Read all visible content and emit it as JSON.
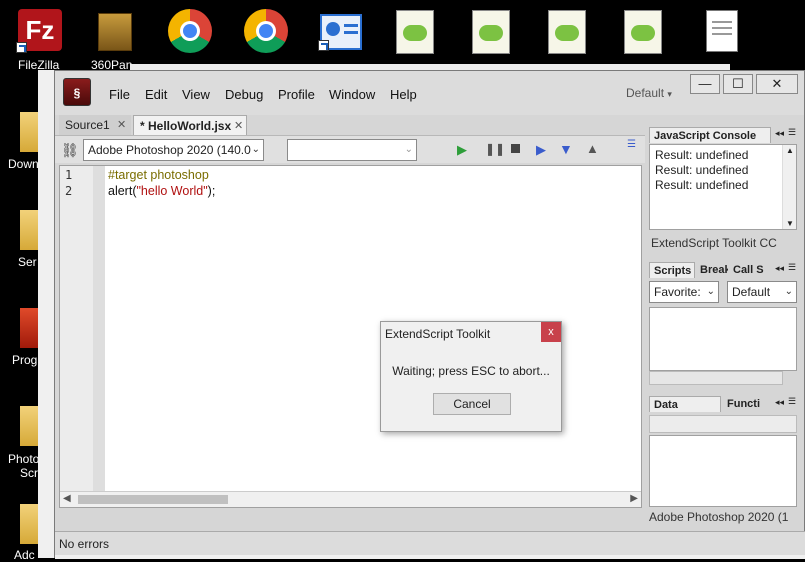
{
  "desktop": {
    "icons": [
      {
        "label": "FileZilla",
        "icon": "filezilla-icon"
      },
      {
        "label": "360Pan",
        "icon": "folder-icon"
      },
      {
        "label": "",
        "icon": "chrome-icon"
      },
      {
        "label": "",
        "icon": "chrome-icon"
      },
      {
        "label": "",
        "icon": "app-shortcut-icon"
      },
      {
        "label": "",
        "icon": "notepad-plus-plus-icon"
      },
      {
        "label": "",
        "icon": "notepad-plus-plus-icon"
      },
      {
        "label": "",
        "icon": "notepad-plus-plus-icon"
      },
      {
        "label": "",
        "icon": "notepad-plus-plus-icon"
      },
      {
        "label": "",
        "icon": "text-document-icon"
      }
    ],
    "left_labels": [
      "Down",
      "Ser",
      "Prog",
      "Photo",
      "Scr",
      "Adc"
    ]
  },
  "window": {
    "menu": [
      "File",
      "Edit",
      "View",
      "Debug",
      "Profile",
      "Window",
      "Help"
    ],
    "workspace": "Default",
    "controls": {
      "minimize": "—",
      "maximize": "☐",
      "close": "✕"
    },
    "tabs": [
      "Source1",
      "* HelloWorld.jsx"
    ],
    "target_app": "Adobe Photoshop 2020 (140.0",
    "function_select": "",
    "code_lines": [
      {
        "num": "1",
        "text": "#target photoshop"
      },
      {
        "num": "2",
        "text_parts": [
          "alert(",
          "\"hello World\"",
          ");"
        ]
      }
    ],
    "status": "No errors"
  },
  "console": {
    "title": "JavaScript Console",
    "lines": [
      "Result: undefined",
      "Result: undefined",
      "Result: undefined"
    ],
    "footer": "ExtendScript Toolkit CC"
  },
  "scripts_panel": {
    "tabs": [
      "Scripts",
      "Break",
      "Call S"
    ],
    "favorites": "Favorite:",
    "default": "Default"
  },
  "data_panel": {
    "tabs": [
      "Data Browser",
      "Functi"
    ],
    "footer": "Adobe Photoshop 2020 (1"
  },
  "dialog": {
    "title": "ExtendScript Toolkit",
    "message": "Waiting; press ESC to abort...",
    "button": "Cancel"
  },
  "colors": {
    "keyword": "#7a6d00",
    "string": "#b01010",
    "play": "#2e9e3a",
    "blue_ctrl": "#3a5ccc"
  }
}
